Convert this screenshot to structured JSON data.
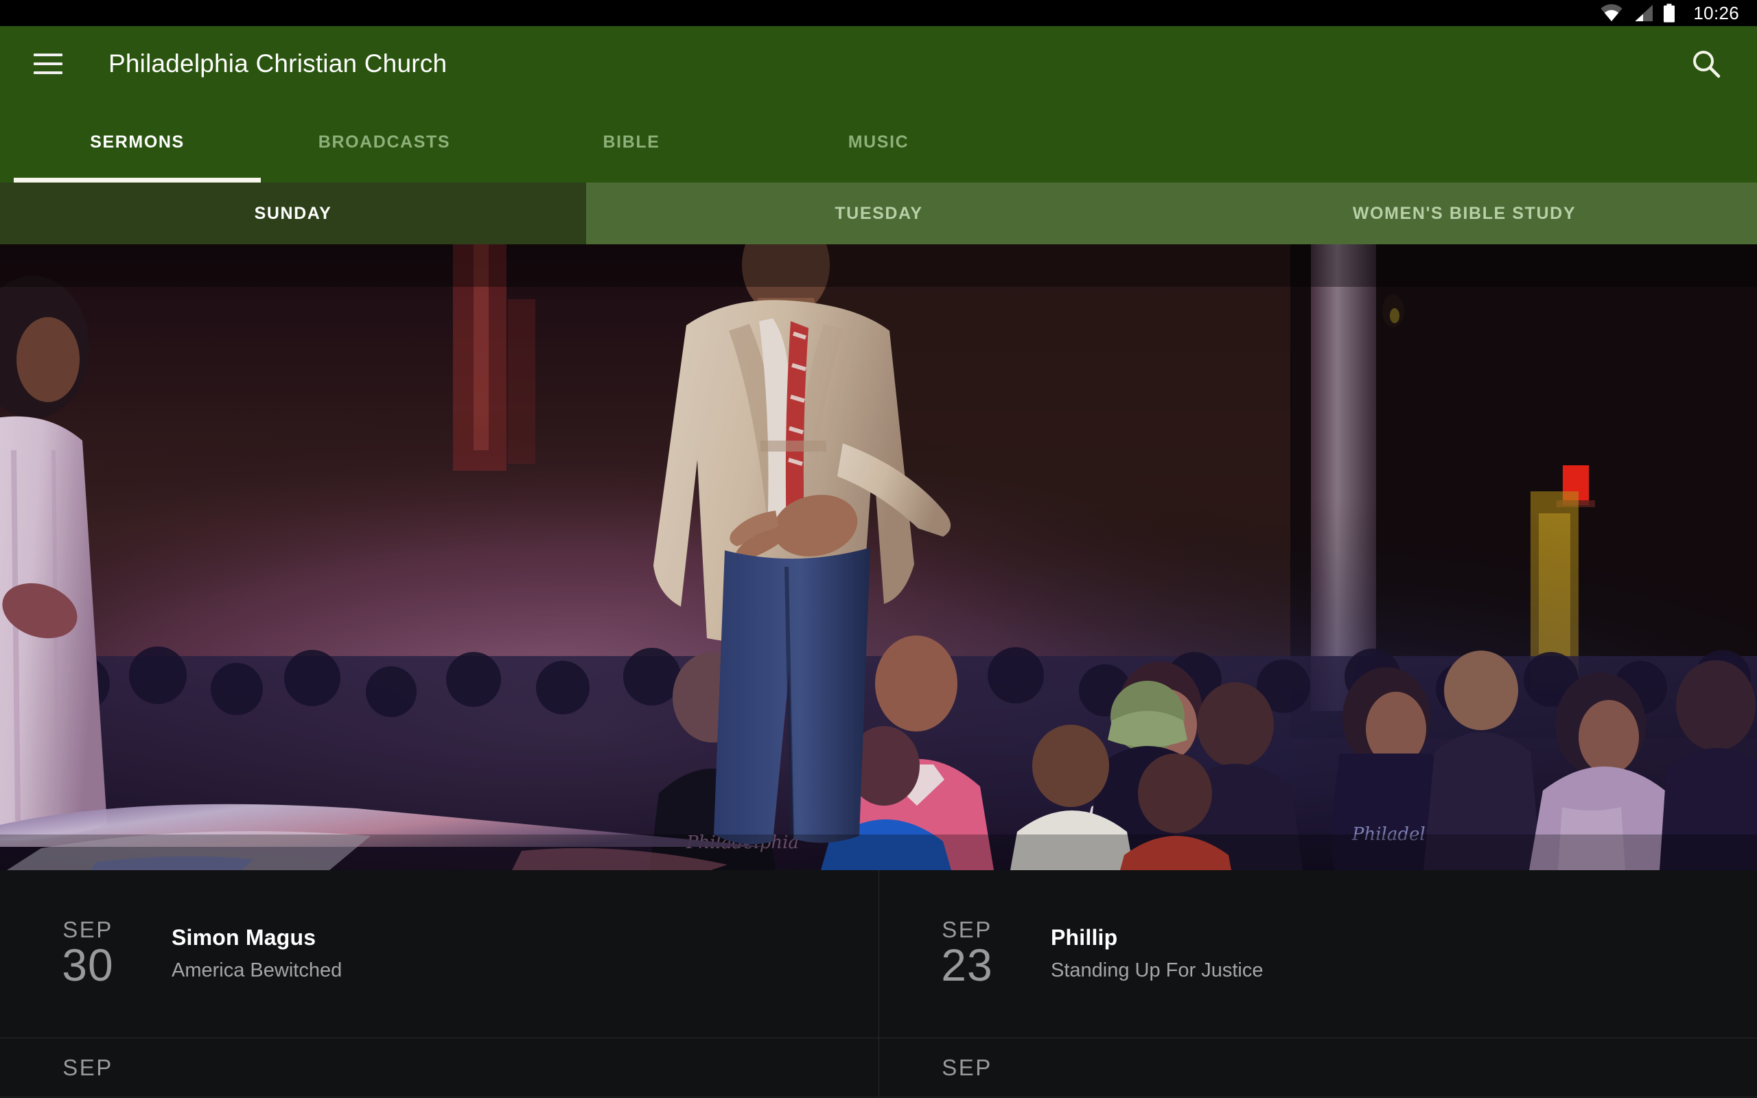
{
  "status_bar": {
    "time": "10:26",
    "icons": [
      "wifi-icon",
      "cellular-signal-icon",
      "battery-icon"
    ]
  },
  "app_bar": {
    "title": "Philadelphia Christian Church",
    "menu_icon": "hamburger-menu-icon",
    "search_icon": "search-icon",
    "background_color": "#2a5410"
  },
  "tabs": [
    {
      "label": "SERMONS",
      "active": true
    },
    {
      "label": "BROADCASTS",
      "active": false
    },
    {
      "label": "BIBLE",
      "active": false
    },
    {
      "label": "MUSIC",
      "active": false
    }
  ],
  "subtabs": [
    {
      "label": "SUNDAY",
      "active": true
    },
    {
      "label": "TUESDAY",
      "active": false
    },
    {
      "label": "WOMEN'S BIBLE STUDY",
      "active": false
    }
  ],
  "hero": {
    "alt": "Congregation standing in prayer under purple stage lighting with pastor in foreground"
  },
  "sermons": [
    {
      "month": "SEP",
      "day": "30",
      "title": "Simon Magus",
      "subtitle": "America Bewitched"
    },
    {
      "month": "SEP",
      "day": "23",
      "title": "Phillip",
      "subtitle": "Standing Up For Justice"
    },
    {
      "month": "SEP",
      "day": "",
      "title": "",
      "subtitle": ""
    },
    {
      "month": "SEP",
      "day": "",
      "title": "",
      "subtitle": ""
    }
  ],
  "colors": {
    "primary_green": "#2a5410",
    "subtab_active": "#2d4019",
    "subtab_inactive": "#4c6b35",
    "list_background": "#111213",
    "accent_white": "#f6f6ec"
  }
}
